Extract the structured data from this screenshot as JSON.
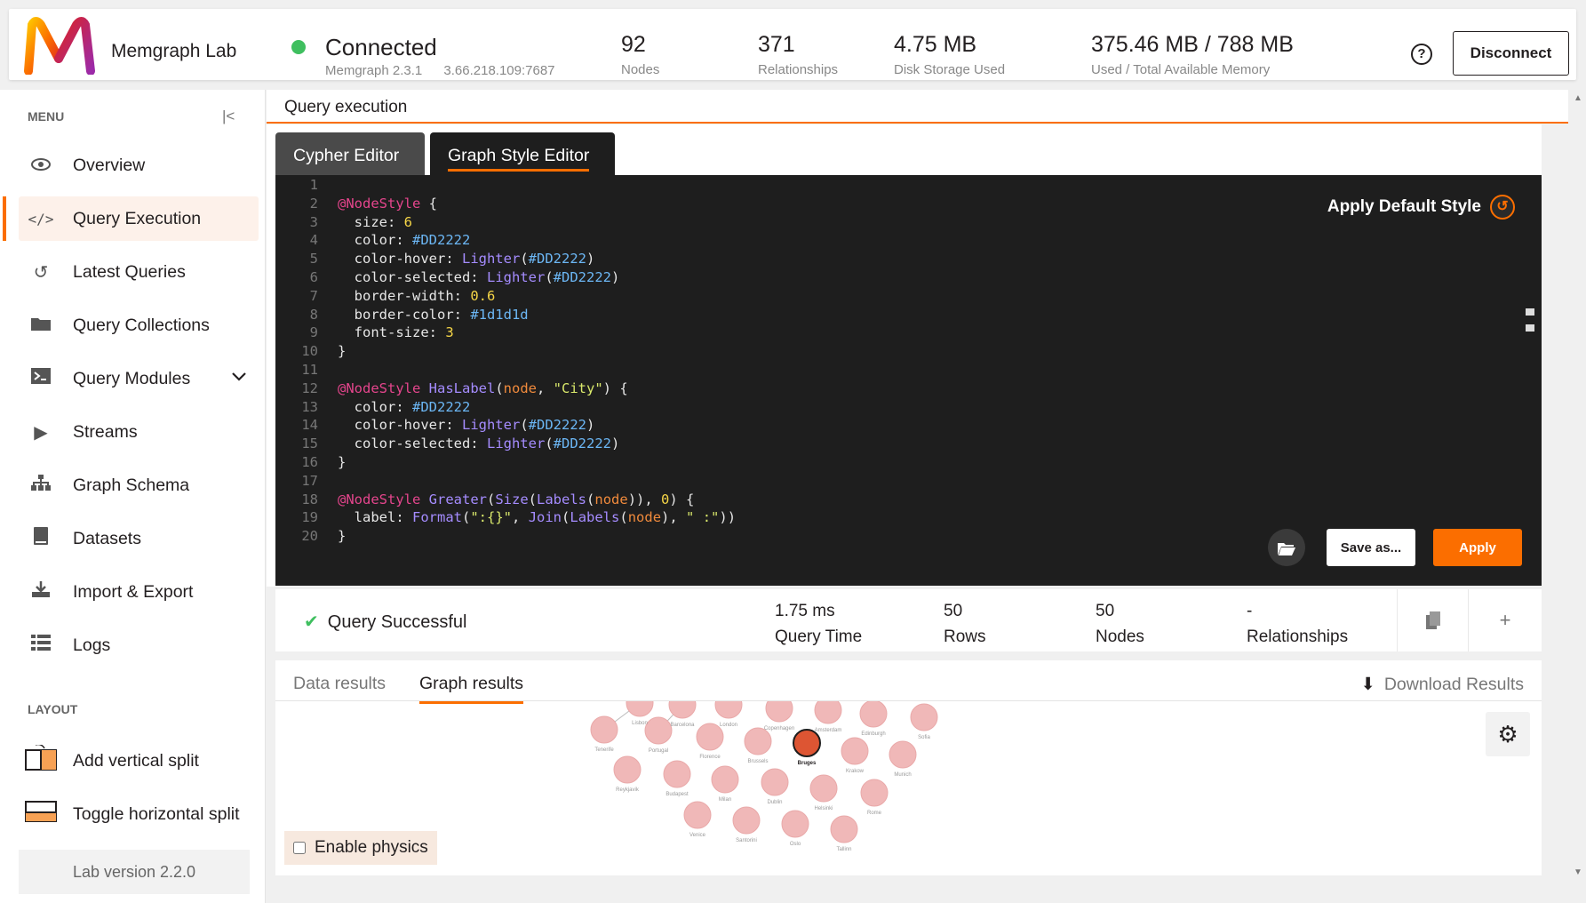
{
  "header": {
    "app_name": "Memgraph Lab",
    "status": "Connected",
    "version": "Memgraph 2.3.1",
    "address": "3.66.218.109:7687",
    "stats": [
      {
        "value": "92",
        "label": "Nodes"
      },
      {
        "value": "371",
        "label": "Relationships"
      },
      {
        "value": "4.75 MB",
        "label": "Disk Storage Used"
      },
      {
        "value": "375.46 MB / 788 MB",
        "label": "Used / Total Available Memory"
      }
    ],
    "help_icon": "?",
    "disconnect_label": "Disconnect"
  },
  "sidebar": {
    "menu_label": "MENU",
    "collapse_icon": "|<",
    "items": [
      {
        "label": "Overview",
        "icon": "eye-icon"
      },
      {
        "label": "Query Execution",
        "icon": "code-icon"
      },
      {
        "label": "Latest Queries",
        "icon": "history-icon"
      },
      {
        "label": "Query Collections",
        "icon": "folder-icon"
      },
      {
        "label": "Query Modules",
        "icon": "terminal-icon"
      },
      {
        "label": "Streams",
        "icon": "play-icon"
      },
      {
        "label": "Graph Schema",
        "icon": "schema-icon"
      },
      {
        "label": "Datasets",
        "icon": "book-icon"
      },
      {
        "label": "Import & Export",
        "icon": "download-icon"
      },
      {
        "label": "Logs",
        "icon": "list-icon"
      }
    ],
    "layout_label": "LAYOUT",
    "layout_items": [
      {
        "label": "Add vertical split"
      },
      {
        "label": "Toggle horizontal split"
      }
    ],
    "version": "Lab version 2.2.0"
  },
  "main": {
    "title": "Query execution",
    "tabs": [
      {
        "label": "Cypher Editor"
      },
      {
        "label": "Graph Style Editor"
      }
    ],
    "apply_default": "Apply Default Style",
    "save_as": "Save as...",
    "apply": "Apply",
    "code_lines": [
      [],
      [
        [
          "k-pink",
          "@NodeStyle"
        ],
        [
          "k-white",
          " {"
        ]
      ],
      [
        [
          "k-white",
          "  size: "
        ],
        [
          "k-yellow",
          "6"
        ]
      ],
      [
        [
          "k-white",
          "  color: "
        ],
        [
          "k-blue",
          "#DD2222"
        ]
      ],
      [
        [
          "k-white",
          "  color-hover: "
        ],
        [
          "k-purple",
          "Lighter"
        ],
        [
          "k-white",
          "("
        ],
        [
          "k-blue",
          "#DD2222"
        ],
        [
          "k-white",
          ")"
        ]
      ],
      [
        [
          "k-white",
          "  color-selected: "
        ],
        [
          "k-purple",
          "Lighter"
        ],
        [
          "k-white",
          "("
        ],
        [
          "k-blue",
          "#DD2222"
        ],
        [
          "k-white",
          ")"
        ]
      ],
      [
        [
          "k-white",
          "  border-width: "
        ],
        [
          "k-yellow",
          "0.6"
        ]
      ],
      [
        [
          "k-white",
          "  border-color: "
        ],
        [
          "k-blue",
          "#1d1d1d"
        ]
      ],
      [
        [
          "k-white",
          "  font-size: "
        ],
        [
          "k-yellow",
          "3"
        ]
      ],
      [
        [
          "k-white",
          "}"
        ]
      ],
      [],
      [
        [
          "k-pink",
          "@NodeStyle"
        ],
        [
          "k-white",
          " "
        ],
        [
          "k-purple",
          "HasLabel"
        ],
        [
          "k-white",
          "("
        ],
        [
          "k-orange",
          "node"
        ],
        [
          "k-white",
          ", "
        ],
        [
          "k-green",
          "\"City\""
        ],
        [
          "k-white",
          ") {"
        ]
      ],
      [
        [
          "k-white",
          "  color: "
        ],
        [
          "k-blue",
          "#DD2222"
        ]
      ],
      [
        [
          "k-white",
          "  color-hover: "
        ],
        [
          "k-purple",
          "Lighter"
        ],
        [
          "k-white",
          "("
        ],
        [
          "k-blue",
          "#DD2222"
        ],
        [
          "k-white",
          ")"
        ]
      ],
      [
        [
          "k-white",
          "  color-selected: "
        ],
        [
          "k-purple",
          "Lighter"
        ],
        [
          "k-white",
          "("
        ],
        [
          "k-blue",
          "#DD2222"
        ],
        [
          "k-white",
          ")"
        ]
      ],
      [
        [
          "k-white",
          "}"
        ]
      ],
      [],
      [
        [
          "k-pink",
          "@NodeStyle"
        ],
        [
          "k-white",
          " "
        ],
        [
          "k-purple",
          "Greater"
        ],
        [
          "k-white",
          "("
        ],
        [
          "k-purple",
          "Size"
        ],
        [
          "k-white",
          "("
        ],
        [
          "k-purple",
          "Labels"
        ],
        [
          "k-white",
          "("
        ],
        [
          "k-orange",
          "node"
        ],
        [
          "k-white",
          ")), "
        ],
        [
          "k-yellow",
          "0"
        ],
        [
          "k-white",
          ") {"
        ]
      ],
      [
        [
          "k-white",
          "  label: "
        ],
        [
          "k-purple",
          "Format"
        ],
        [
          "k-white",
          "("
        ],
        [
          "k-green",
          "\":{}\""
        ],
        [
          "k-white",
          ", "
        ],
        [
          "k-purple",
          "Join"
        ],
        [
          "k-white",
          "("
        ],
        [
          "k-purple",
          "Labels"
        ],
        [
          "k-white",
          "("
        ],
        [
          "k-orange",
          "node"
        ],
        [
          "k-white",
          "), "
        ],
        [
          "k-green",
          "\" :\""
        ],
        [
          "k-white",
          "))"
        ]
      ],
      [
        [
          "k-white",
          "}"
        ]
      ]
    ]
  },
  "result": {
    "status": "Query Successful",
    "stats": [
      {
        "value": "1.75 ms",
        "label": "Query Time"
      },
      {
        "value": "50",
        "label": "Rows"
      },
      {
        "value": "50",
        "label": "Nodes"
      },
      {
        "value": "-",
        "label": "Relationships"
      }
    ],
    "tabs": [
      {
        "label": "Data results"
      },
      {
        "label": "Graph results"
      }
    ],
    "download": "Download Results",
    "physics_label": "Enable physics",
    "graph_nodes": [
      {
        "name": "Tenerife"
      },
      {
        "name": "Portugal"
      },
      {
        "name": "Florence"
      },
      {
        "name": "Brussels"
      },
      {
        "name": "Bruges"
      },
      {
        "name": "Krakow"
      },
      {
        "name": "Munich"
      },
      {
        "name": "Reykjavik"
      },
      {
        "name": "Budapest"
      },
      {
        "name": "Milan"
      },
      {
        "name": "Dublin"
      },
      {
        "name": "Helsinki"
      },
      {
        "name": "Rome"
      },
      {
        "name": "Venice"
      },
      {
        "name": "Santorini"
      },
      {
        "name": "Oslo"
      },
      {
        "name": "Tallinn"
      },
      {
        "name": "Edinburgh"
      },
      {
        "name": "Sofia"
      },
      {
        "name": "Amsterdam"
      },
      {
        "name": "Copenhagen"
      },
      {
        "name": "London"
      },
      {
        "name": "Barcelona"
      },
      {
        "name": "Lisbon"
      }
    ]
  },
  "colors": {
    "accent": "#fb6e00",
    "success": "#3fbf5f",
    "node_fill": "#f0b8b8",
    "node_selected": "#dd5533",
    "editor_bg": "#1e1e1e"
  }
}
